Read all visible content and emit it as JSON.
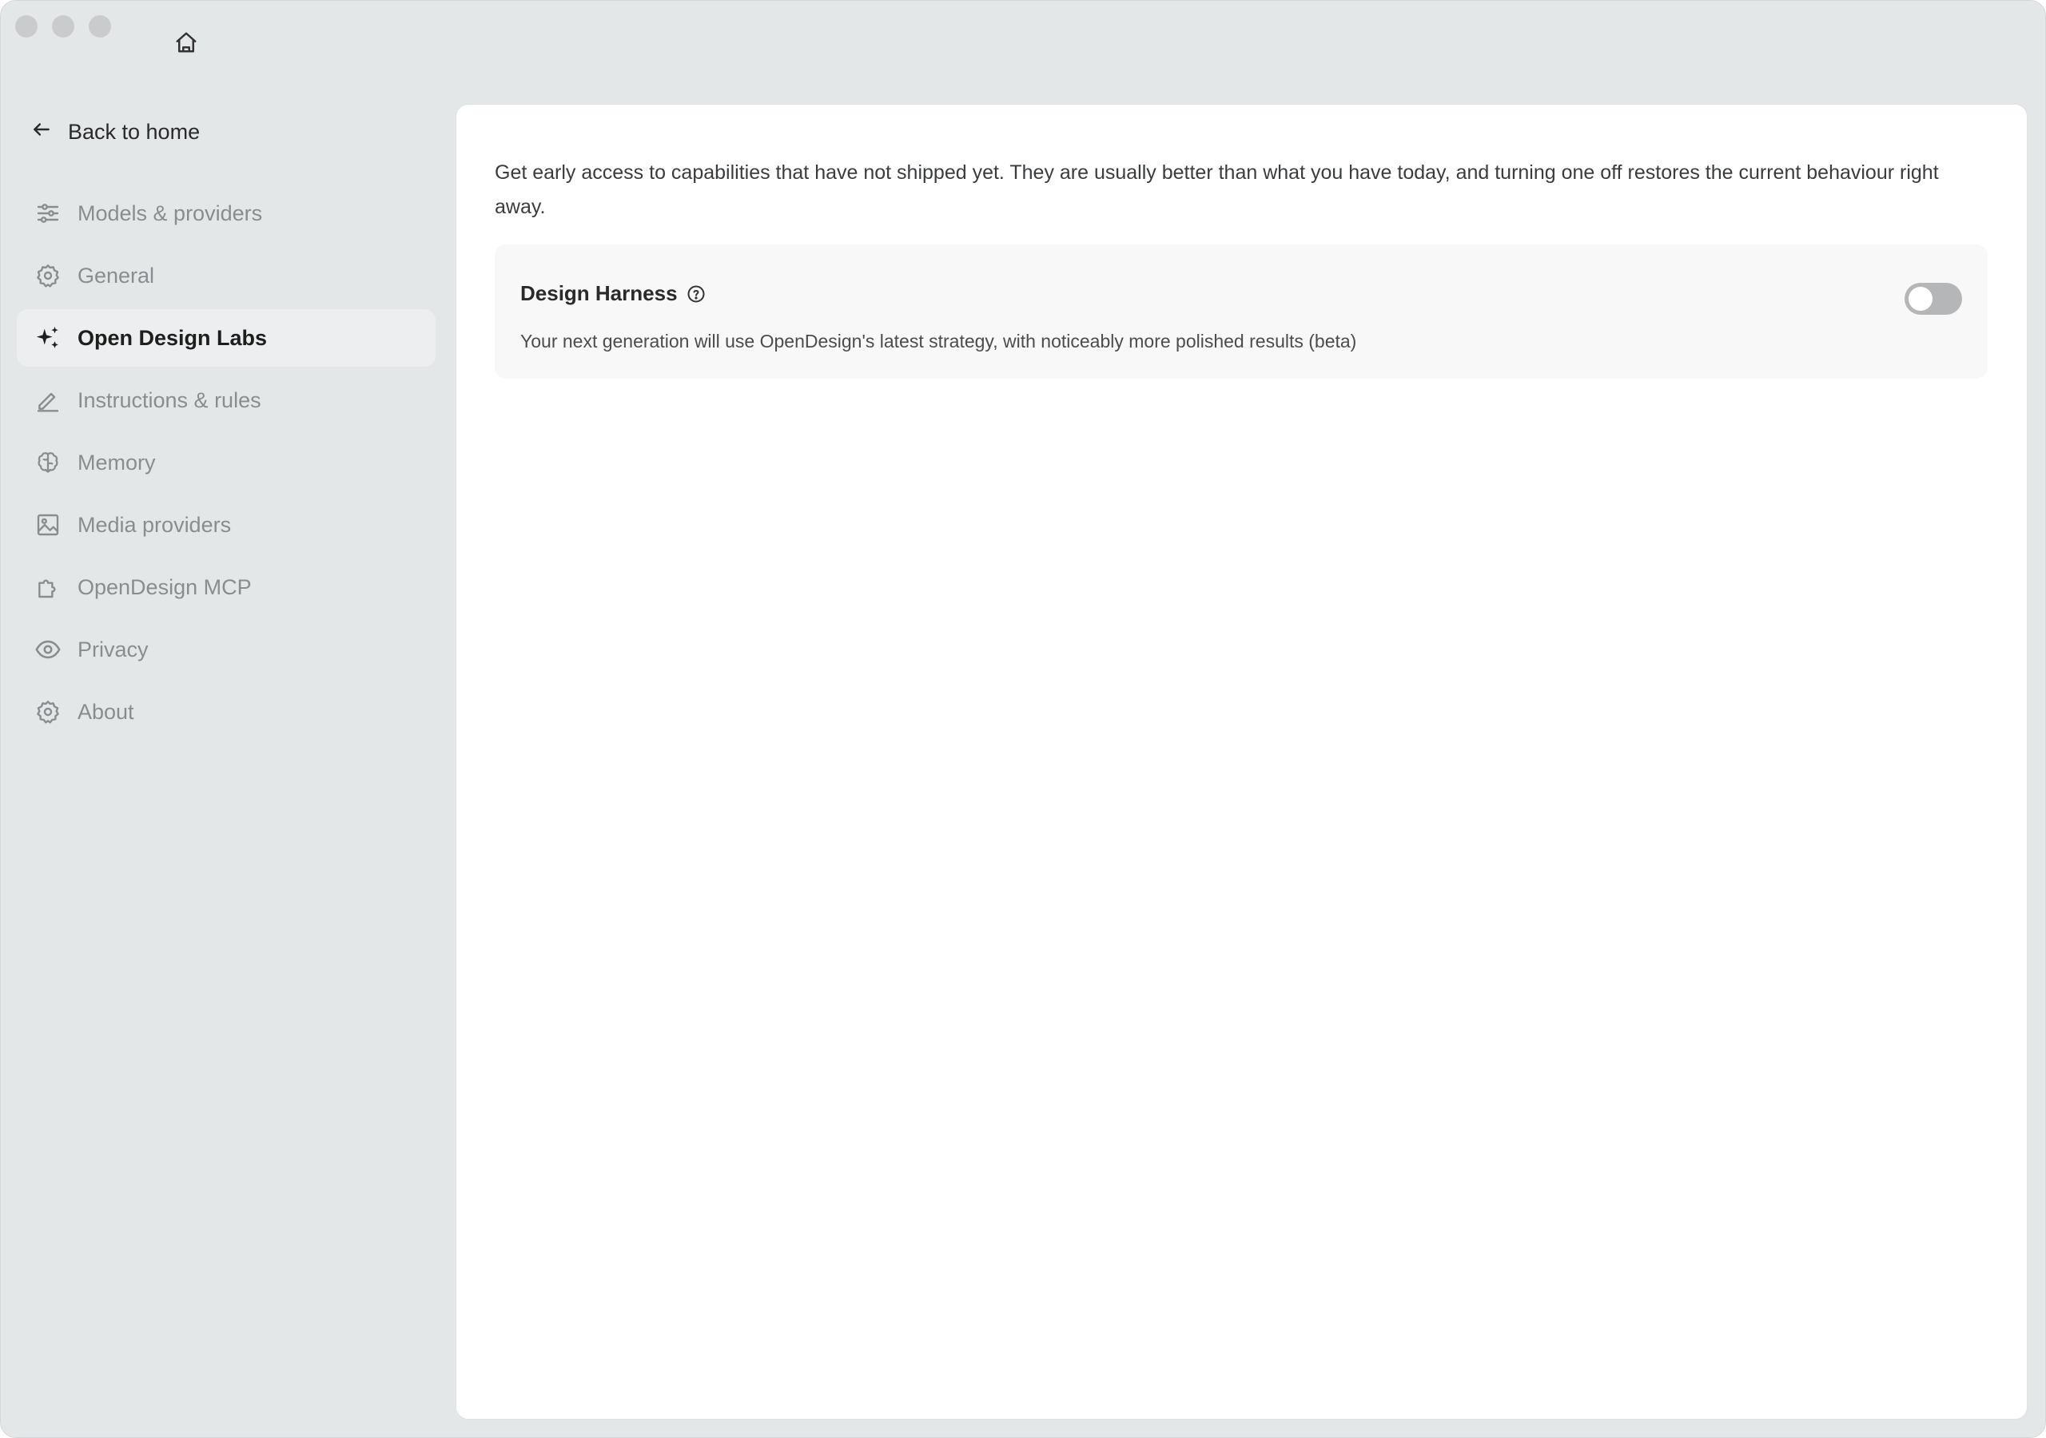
{
  "sidebar": {
    "back_label": "Back to home",
    "items": [
      {
        "label": "Models & providers",
        "icon": "sliders-icon",
        "active": false
      },
      {
        "label": "General",
        "icon": "gear-icon",
        "active": false
      },
      {
        "label": "Open Design Labs",
        "icon": "sparkles-icon",
        "active": true
      },
      {
        "label": "Instructions & rules",
        "icon": "pencil-icon",
        "active": false
      },
      {
        "label": "Memory",
        "icon": "brain-icon",
        "active": false
      },
      {
        "label": "Media providers",
        "icon": "image-icon",
        "active": false
      },
      {
        "label": "OpenDesign MCP",
        "icon": "puzzle-icon",
        "active": false
      },
      {
        "label": "Privacy",
        "icon": "eye-icon",
        "active": false
      },
      {
        "label": "About",
        "icon": "gear-icon",
        "active": false
      }
    ]
  },
  "main": {
    "intro": "Get early access to capabilities that have not shipped yet. They are usually better than what you have today, and turning one off restores the current behaviour right away.",
    "feature": {
      "title": "Design Harness",
      "description": "Your next generation will use OpenDesign's latest strategy, with noticeably more polished results (beta)",
      "enabled": false
    }
  },
  "colors": {
    "window_bg": "#e4e7e8",
    "panel_bg": "#ffffff",
    "active_item_bg": "#eceeef",
    "toggle_off": "#b4b6b8"
  }
}
